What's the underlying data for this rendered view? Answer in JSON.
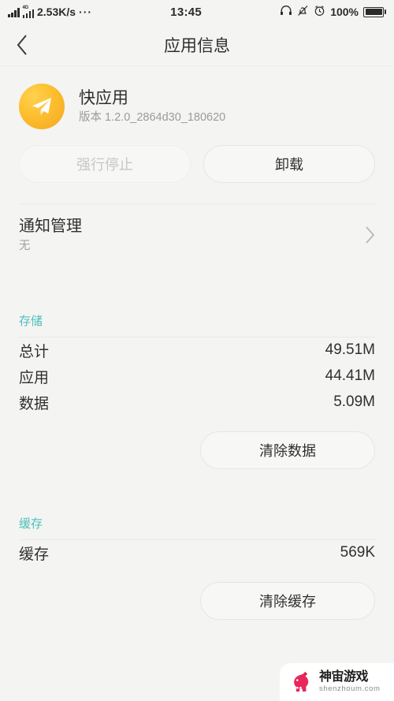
{
  "statusbar": {
    "signal_icon": "signal-bars-icon",
    "network_type": "4G",
    "network_speed": "2.53K/s",
    "overflow": "···",
    "time": "13:45",
    "headphone_icon": "headphone-icon",
    "mute_icon": "bell-muted-icon",
    "alarm_icon": "alarm-clock-icon",
    "battery_percent": "100%",
    "battery_level": 100
  },
  "titlebar": {
    "back_icon": "chevron-left-icon",
    "title": "应用信息"
  },
  "app": {
    "icon": "paper-plane-icon",
    "name": "快应用",
    "version": "版本 1.2.0_2864d30_180620"
  },
  "actions": {
    "force_stop": {
      "label": "强行停止",
      "enabled": false
    },
    "uninstall": {
      "label": "卸载",
      "enabled": true
    }
  },
  "notification": {
    "title": "通知管理",
    "subtitle": "无",
    "chevron_icon": "chevron-right-icon"
  },
  "storage": {
    "header": "存储",
    "rows": [
      {
        "label": "总计",
        "value": "49.51M"
      },
      {
        "label": "应用",
        "value": "44.41M"
      },
      {
        "label": "数据",
        "value": "5.09M"
      }
    ],
    "button": "清除数据"
  },
  "cache": {
    "header": "缓存",
    "rows": [
      {
        "label": "缓存",
        "value": "569K"
      }
    ],
    "button": "清除缓存"
  },
  "watermark": {
    "logo_icon": "unicorn-logo-icon",
    "name_cn": "神宙游戏",
    "name_en": "shenzhoum.com"
  },
  "colors": {
    "background": "#f4f4f3",
    "accent_teal": "#4dbfb8",
    "app_icon": "#f5a623",
    "text_primary": "#2f2f2f",
    "text_secondary": "#9b9b9b",
    "watermark_pink": "#e8275a"
  }
}
